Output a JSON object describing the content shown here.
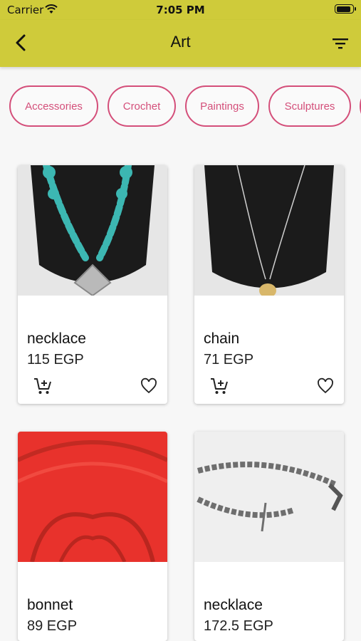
{
  "status": {
    "carrier": "Carrier",
    "time": "7:05 PM",
    "battery_level": 0.9
  },
  "header": {
    "title": "Art"
  },
  "categories": [
    "Accessories",
    "Crochet",
    "Paintings",
    "Sculptures"
  ],
  "products": [
    {
      "name": "necklace",
      "price": "115 EGP"
    },
    {
      "name": "chain",
      "price": "71 EGP"
    },
    {
      "name": "bonnet",
      "price": "89 EGP"
    },
    {
      "name": "necklace",
      "price": "172.5 EGP"
    }
  ],
  "colors": {
    "app_bar": "#cfcb3a",
    "chip_accent": "#d44f7a"
  },
  "icons": {
    "back": "chevron-left-icon",
    "filter": "filter-lines-icon",
    "cart": "add-to-cart-icon",
    "favorite": "heart-outline-icon"
  }
}
